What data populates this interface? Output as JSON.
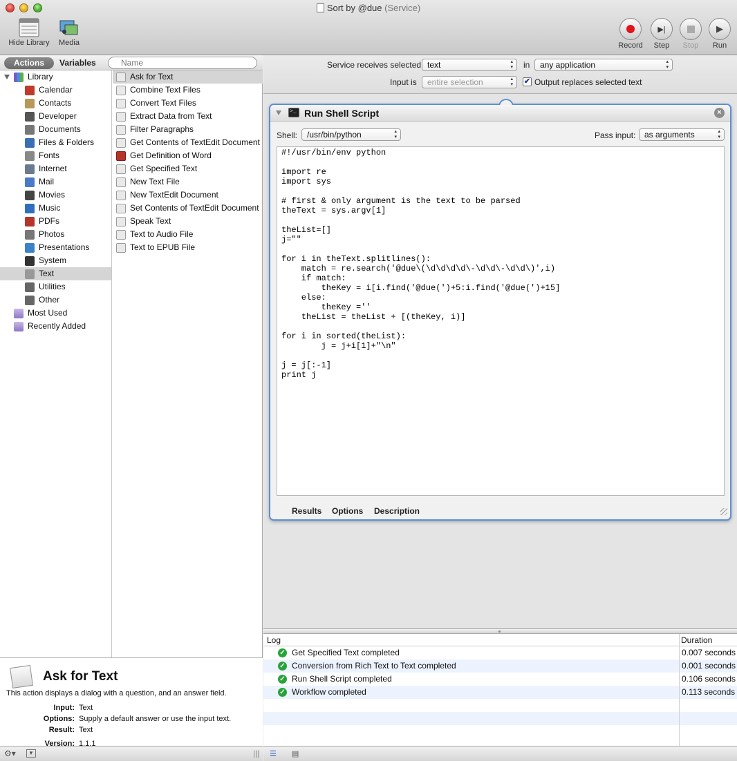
{
  "window": {
    "title": "Sort by @due",
    "subtitle": "(Service)"
  },
  "toolbar": {
    "hide_library": "Hide Library",
    "media": "Media",
    "record": "Record",
    "step": "Step",
    "stop": "Stop",
    "run": "Run"
  },
  "library": {
    "tab_actions": "Actions",
    "tab_variables": "Variables",
    "search_placeholder": "Name",
    "root": "Library",
    "categories": [
      "Calendar",
      "Contacts",
      "Developer",
      "Documents",
      "Files & Folders",
      "Fonts",
      "Internet",
      "Mail",
      "Movies",
      "Music",
      "PDFs",
      "Photos",
      "Presentations",
      "System",
      "Text",
      "Utilities",
      "Other"
    ],
    "selected_category": "Text",
    "extra": [
      "Most Used",
      "Recently Added"
    ]
  },
  "actions": {
    "items": [
      "Ask for Text",
      "Combine Text Files",
      "Convert Text Files",
      "Extract Data from Text",
      "Filter Paragraphs",
      "Get Contents of TextEdit Document",
      "Get Definition of Word",
      "Get Specified Text",
      "New Text File",
      "New TextEdit Document",
      "Set Contents of TextEdit Document",
      "Speak Text",
      "Text to Audio File",
      "Text to EPUB File"
    ],
    "selected": "Ask for Text"
  },
  "description": {
    "title": "Ask for Text",
    "text": "This action displays a dialog with a question, and an answer field.",
    "input_label": "Input:",
    "input_value": "Text",
    "options_label": "Options:",
    "options_value": "Supply a default answer or use the input text.",
    "result_label": "Result:",
    "result_value": "Text",
    "version_label": "Version:",
    "version_value": "1.1.1"
  },
  "service": {
    "receives_label": "Service receives selected",
    "receives_value": "text",
    "in_label": "in",
    "app_value": "any application",
    "input_is_label": "Input is",
    "input_is_value": "entire selection",
    "output_replaces_label": "Output replaces selected text",
    "output_replaces_checked": "✔"
  },
  "action_card": {
    "title": "Run Shell Script",
    "shell_label": "Shell:",
    "shell_value": "/usr/bin/python",
    "pass_input_label": "Pass input:",
    "pass_input_value": "as arguments",
    "code": "#!/usr/bin/env python\n\nimport re\nimport sys\n\n# first & only argument is the text to be parsed\ntheText = sys.argv[1]\n\ntheList=[]\nj=\"\"\n\nfor i in theText.splitlines():\n    match = re.search('@due\\(\\d\\d\\d\\d\\-\\d\\d\\-\\d\\d\\)',i)\n    if match:\n        theKey = i[i.find('@due(')+5:i.find('@due(')+15]\n    else:\n        theKey =''\n    theList = theList + [(theKey, i)]\n\nfor i in sorted(theList):\n        j = j+i[1]+\"\\n\"\n\nj = j[:-1]\nprint j",
    "tabs": [
      "Results",
      "Options",
      "Description"
    ]
  },
  "log": {
    "col_log": "Log",
    "col_duration": "Duration",
    "rows": [
      {
        "message": "Get Specified Text completed",
        "duration": "0.007 seconds"
      },
      {
        "message": "Conversion from Rich Text to Text completed",
        "duration": "0.001 seconds"
      },
      {
        "message": "Run Shell Script completed",
        "duration": "0.106 seconds"
      },
      {
        "message": "Workflow completed",
        "duration": "0.113 seconds"
      }
    ]
  },
  "colors": {
    "accent": "#5a90d6",
    "success": "#27a33a",
    "record": "#e0141a"
  }
}
